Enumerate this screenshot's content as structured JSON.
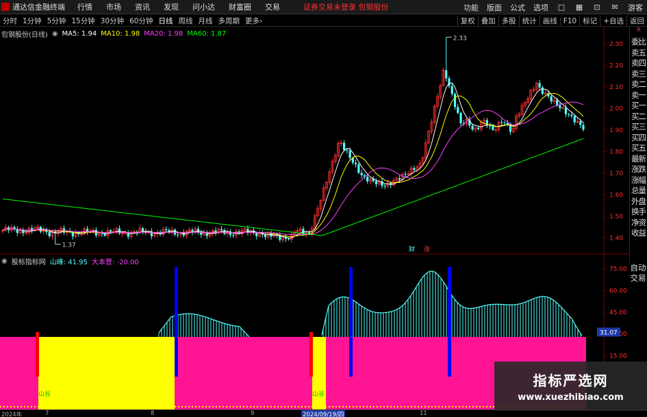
{
  "app": {
    "title": "通达信金融终端",
    "logo_icon": "tdx-logo-icon"
  },
  "menu": [
    "行情",
    "市场",
    "资讯",
    "发现",
    "问小达",
    "财富圈",
    "交易"
  ],
  "status_text": "证券交易未登录",
  "stock_name_header": "包钢股份",
  "right_menu": [
    "功能",
    "版面",
    "公式",
    "选项"
  ],
  "user": "游客",
  "toolbar": {
    "periods": [
      "分时",
      "1分钟",
      "5分钟",
      "15分钟",
      "30分钟",
      "60分钟",
      "日线",
      "周线",
      "月线",
      "多周期",
      "更多"
    ],
    "active_period_index": 6,
    "right_buttons": [
      "复权",
      "叠加",
      "多股",
      "统计",
      "画线",
      "F10",
      "标记",
      "+自选",
      "返回"
    ]
  },
  "main_legend": {
    "title": "包钢股份(日线)",
    "ma5": "MA5: 1.94",
    "ma10": "MA10: 1.98",
    "ma20": "MA20: 1.98",
    "ma60": "MA60: 1.87",
    "colors": {
      "ma5": "#ffffff",
      "ma10": "#ffff00",
      "ma20": "#ff40ff",
      "ma60": "#00ff00"
    }
  },
  "chart_data": {
    "type": "candlestick",
    "price_axis_ticks": [
      "2.30",
      "2.20",
      "2.10",
      "2.00",
      "1.90",
      "1.80",
      "1.70",
      "1.60",
      "1.50",
      "1.40"
    ],
    "ylim": [
      1.35,
      2.35
    ],
    "high_label": "2.33",
    "low_label": "1.37",
    "markers": [
      "财",
      "涨"
    ],
    "colors": {
      "up": "#ff3030",
      "down": "#54ffff"
    },
    "sub_indicator": {
      "title": "股标指标网",
      "series": [
        {
          "name": "山峰",
          "value_label": "山峰: 41.95",
          "color": "#54ffff"
        },
        {
          "name": "大本营",
          "value_label": "大本营: -20.00",
          "color": "#ff1493"
        }
      ],
      "axis_ticks": [
        "75.00",
        "60.00",
        "45.00",
        "30.00",
        "15.00"
      ],
      "current_value": "31.07",
      "zone_labels": [
        "山谷",
        "山谷"
      ]
    }
  },
  "right_panel": [
    "委比",
    "卖五",
    "卖四",
    "卖三",
    "卖二",
    "卖一",
    "买一",
    "买二",
    "买三",
    "买四",
    "买五",
    "最新",
    "涨跌",
    "涨幅",
    "总量",
    "外盘",
    "换手",
    "净资",
    "收益"
  ],
  "right_panel_top": "R",
  "sub_right": [
    "自动",
    "交易"
  ],
  "bottom_axis": {
    "labels": [
      "2024年",
      "7",
      "8",
      "9",
      "11"
    ],
    "highlight": "2024/09/19/四"
  },
  "watermark": {
    "title": "指标严选网",
    "url": "www.xuezhibiao.com"
  }
}
